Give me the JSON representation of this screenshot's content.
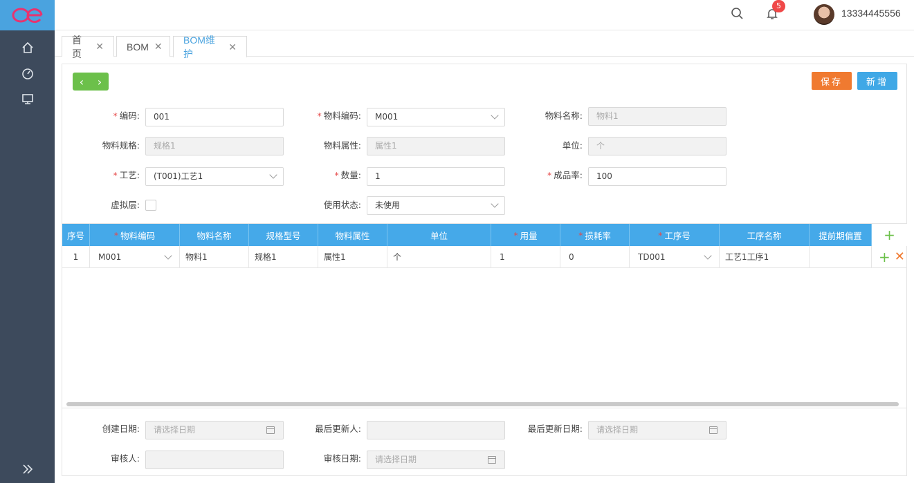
{
  "topbar": {
    "username": "13334445556",
    "notification_count": "5"
  },
  "tabs": [
    {
      "label": "首页"
    },
    {
      "label": "BOM"
    },
    {
      "label": "BOM维护"
    }
  ],
  "toolbar": {
    "save_label": "保存",
    "add_label": "新增"
  },
  "form": {
    "code_label": "编码:",
    "code_value": "001",
    "material_code_label": "物料编码:",
    "material_code_value": "M001",
    "material_name_label": "物料名称:",
    "material_name_placeholder": "物料1",
    "spec_label": "物料规格:",
    "spec_placeholder": "规格1",
    "attr_label": "物料属性:",
    "attr_placeholder": "属性1",
    "unit_label": "单位:",
    "unit_placeholder": "个",
    "process_label": "工艺:",
    "process_value": "(T001)工艺1",
    "qty_label": "数量:",
    "qty_value": "1",
    "yield_label": "成品率:",
    "yield_value": "100",
    "virtual_label": "虚拟层:",
    "status_label": "使用状态:",
    "status_value": "未使用"
  },
  "grid": {
    "headers": [
      "序号",
      "物料编码",
      "物料名称",
      "规格型号",
      "物料属性",
      "单位",
      "用量",
      "损耗率",
      "工序号",
      "工序名称",
      "提前期偏置"
    ],
    "rows": [
      [
        "1",
        "M001",
        "物料1",
        "规格1",
        "属性1",
        "个",
        "1",
        "0",
        "TD001",
        "工艺1工序1",
        ""
      ]
    ]
  },
  "footer": {
    "created_label": "创建日期:",
    "created_placeholder": "请选择日期",
    "updater_label": "最后更新人:",
    "updated_label": "最后更新日期:",
    "updated_placeholder": "请选择日期",
    "reviewer_label": "审核人:",
    "review_date_label": "审核日期:",
    "review_date_placeholder": "请选择日期"
  },
  "colors": {
    "sidebar": "#3d4a5c",
    "accent": "#4aa3df",
    "save": "#f07a30",
    "add": "#40a8e6",
    "nav": "#6cc04a",
    "grid_header": "#45a9e9"
  }
}
